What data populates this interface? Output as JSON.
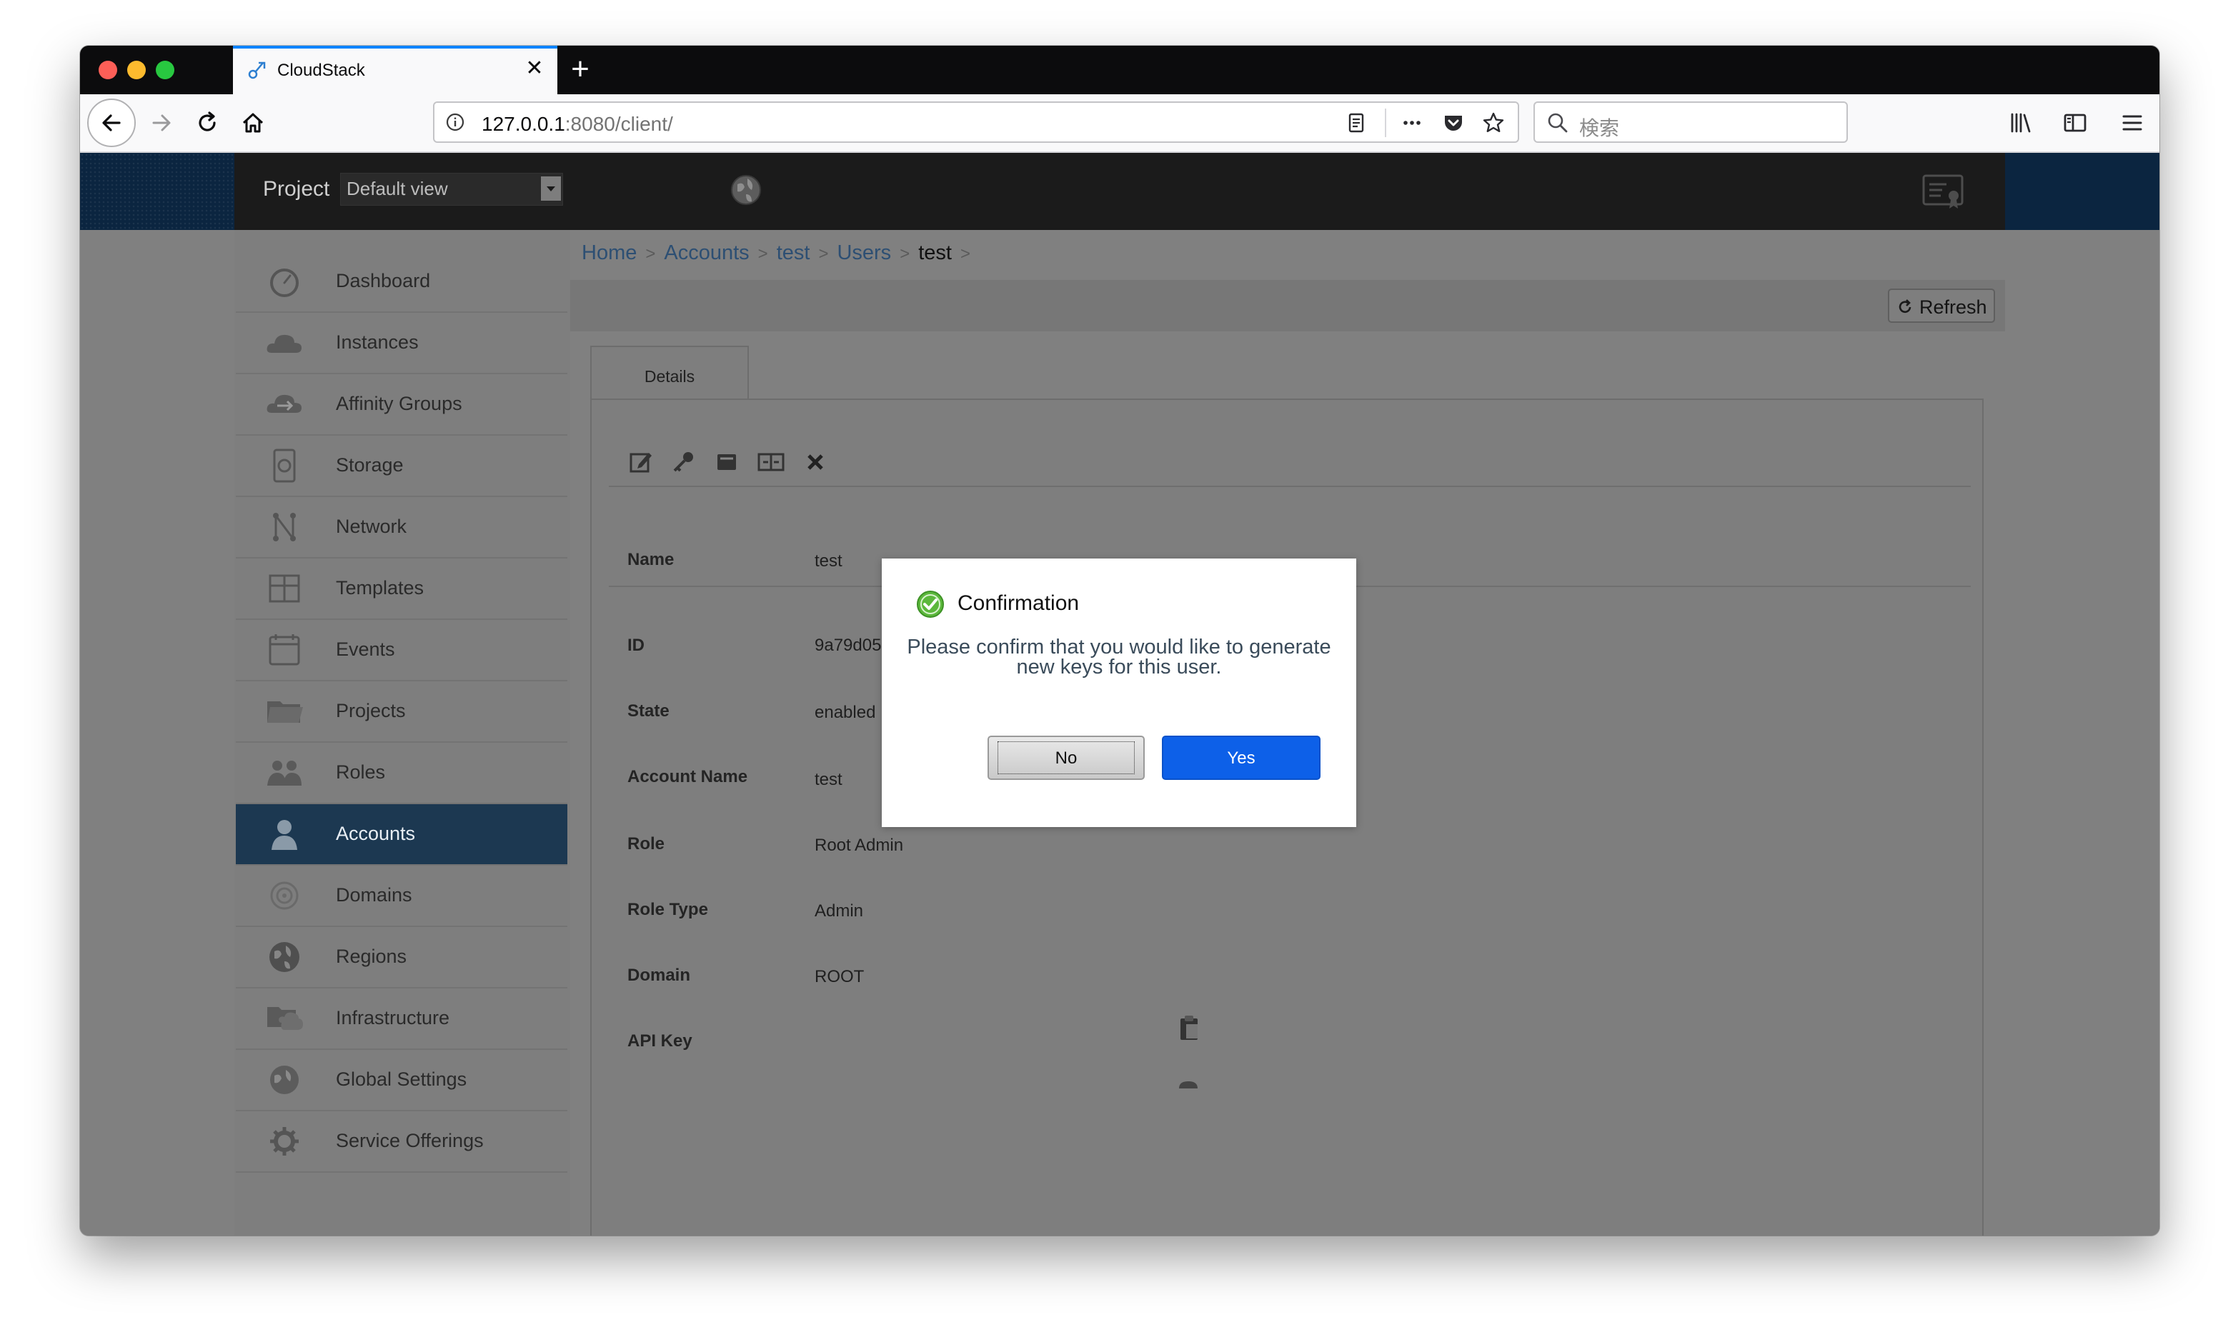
{
  "browser": {
    "tab_title": "CloudStack",
    "url_host": "127.0.0.1",
    "url_rest": ":8080/client/",
    "search_placeholder": "検索",
    "accent_color": "#0a84ff"
  },
  "app_header": {
    "project_label": "Project",
    "project_value": "Default view"
  },
  "sidebar": {
    "items": [
      {
        "label": "Dashboard",
        "icon": "dashboard-gauge-icon"
      },
      {
        "label": "Instances",
        "icon": "cloud-icon"
      },
      {
        "label": "Affinity Groups",
        "icon": "affinity-cloud-icon"
      },
      {
        "label": "Storage",
        "icon": "disk-icon"
      },
      {
        "label": "Network",
        "icon": "network-nodes-icon"
      },
      {
        "label": "Templates",
        "icon": "templates-icon"
      },
      {
        "label": "Events",
        "icon": "calendar-icon"
      },
      {
        "label": "Projects",
        "icon": "folder-icon"
      },
      {
        "label": "Roles",
        "icon": "people-icon"
      },
      {
        "label": "Accounts",
        "icon": "user-icon",
        "active": true
      },
      {
        "label": "Domains",
        "icon": "target-icon"
      },
      {
        "label": "Regions",
        "icon": "globe-icon"
      },
      {
        "label": "Infrastructure",
        "icon": "infrastructure-icon"
      },
      {
        "label": "Global Settings",
        "icon": "globe-settings-icon"
      },
      {
        "label": "Service Offerings",
        "icon": "gear-icon"
      }
    ]
  },
  "breadcrumb": {
    "items": [
      "Home",
      "Accounts",
      "test",
      "Users"
    ],
    "current": "test",
    "separator": ">"
  },
  "toolbar": {
    "refresh_label": "Refresh"
  },
  "details": {
    "tab_label": "Details",
    "rows": [
      {
        "label": "Name",
        "value": "test"
      },
      {
        "label": "ID",
        "value": "9a79d05"
      },
      {
        "label": "State",
        "value": "enabled"
      },
      {
        "label": "Account Name",
        "value": "test"
      },
      {
        "label": "Role",
        "value": "Root Admin"
      },
      {
        "label": "Role Type",
        "value": "Admin"
      },
      {
        "label": "Domain",
        "value": "ROOT"
      },
      {
        "label": "API Key",
        "value": ""
      }
    ]
  },
  "dialog": {
    "title": "Confirmation",
    "message": "Please confirm that you would like to generate new keys for this user.",
    "no_label": "No",
    "yes_label": "Yes",
    "yes_color": "#0d60e8"
  }
}
